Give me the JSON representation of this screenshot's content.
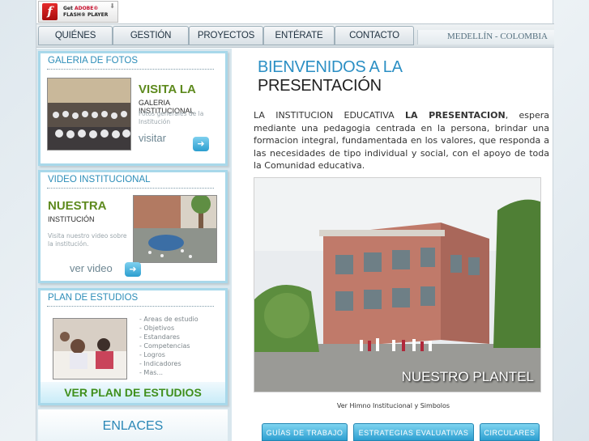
{
  "flash_badge": {
    "line1_prefix": "Get ",
    "line1_brand": "ADOBE®",
    "line2": "FLASH® PLAYER"
  },
  "nav": {
    "items": [
      "QUIÉNES SOMOS",
      "GESTIÓN",
      "PROYECTOS",
      "ENTÉRATE",
      "CONTACTO"
    ],
    "location": "MEDELLÍN - COLOMBIA"
  },
  "sidebar": {
    "gallery": {
      "title": "GALERIA DE FOTOS",
      "heading": "VISITA LA",
      "subheading": "GALERIA INSTITUCIONAL",
      "description": "Fotos generales de la Institución",
      "action": "visitar"
    },
    "video": {
      "title": "VIDEO INSTITUCIONAL",
      "heading": "NUESTRA",
      "subheading": "INSTITUCIÓN",
      "description": "Visita nuestro video sobre la institución.",
      "action": "ver video"
    },
    "plan": {
      "title": "PLAN DE ESTUDIOS",
      "items": [
        "- Areas de estudio",
        "- Objetivos",
        "- Estandares",
        "- Competencias",
        "- Logros",
        "- Indicadores",
        "- Mas..."
      ],
      "cta": "VER PLAN DE ESTUDIOS"
    },
    "links_title": "ENLACES"
  },
  "main": {
    "welcome_line1": "BIENVENIDOS A LA",
    "welcome_line2": "PRESENTACIÓN",
    "intro_before": "LA INSTITUCION EDUCATIVA ",
    "intro_bold": "LA PRESENTACION",
    "intro_after": ", espera mediante una pedagogia centrada en la persona, brindar una formacion integral, fundamentada en los valores, que responda a las necesidades de tipo individual y social, con el apoyo de toda la Comunidad educativa.",
    "photo_caption": "NUESTRO PLANTEL",
    "anthem_link": "Ver Himno Institucional y Simbolos",
    "buttons": [
      "GUÍAS DE TRABAJO",
      "ESTRATEGIAS EVALUATIVAS",
      "CIRCULARES"
    ]
  },
  "colors": {
    "accent_blue": "#2b8fc4",
    "accent_green": "#5e8a1e",
    "panel_border": "#a8d8ea"
  }
}
